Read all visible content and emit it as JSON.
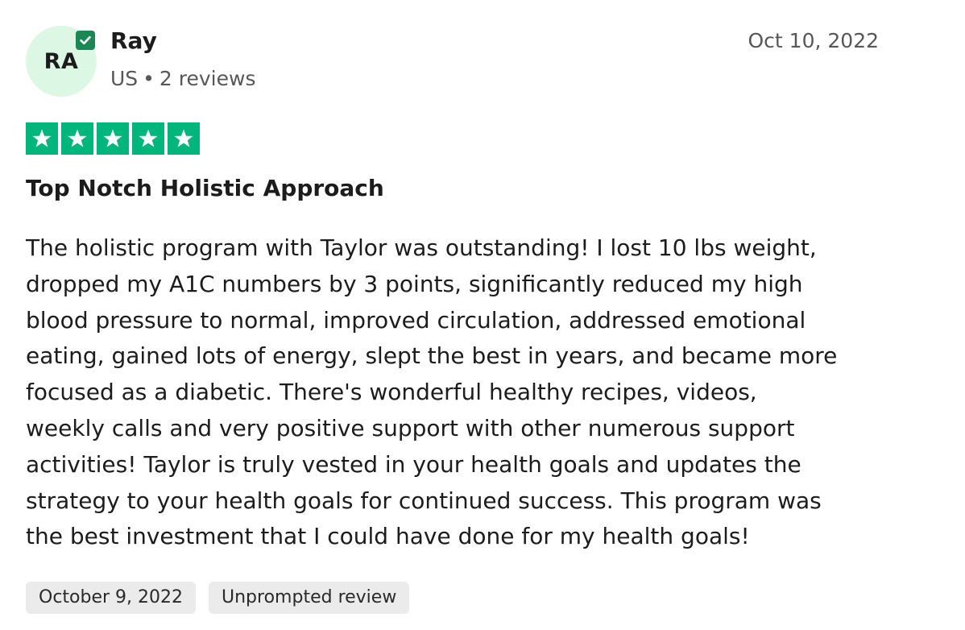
{
  "reviewer": {
    "initials": "RA",
    "name": "Ray",
    "country": "US",
    "separator": "•",
    "review_count": "2 reviews",
    "verified": true
  },
  "review": {
    "date": "Oct 10, 2022",
    "rating": 5,
    "rating_max": 5,
    "title": "Top Notch Holistic Approach",
    "body_lines": [
      "The holistic program with Taylor was outstanding! I lost 10 lbs weight,",
      "dropped my A1C numbers by 3 points, significantly reduced my high",
      "blood pressure to normal, improved circulation, addressed emotional",
      "eating, gained lots of energy, slept the best in years, and became more",
      "focused as a diabetic. There's wonderful healthy recipes, videos,",
      "weekly calls and very positive support with other numerous support",
      "activities! Taylor is truly vested in your health goals and updates the",
      "strategy to your health goals for continued success. This program was",
      "the best investment that I could have done for my health goals!"
    ]
  },
  "tags": {
    "experience_date": "October 9, 2022",
    "review_type": "Unprompted review"
  },
  "colors": {
    "star_fill": "#00b67a",
    "avatar_bg": "#dcf8e4",
    "verified_badge": "#1a8754",
    "tag_bg": "#ebebeb"
  },
  "icons": {
    "star": "star-icon",
    "verified": "verified-check-icon"
  }
}
